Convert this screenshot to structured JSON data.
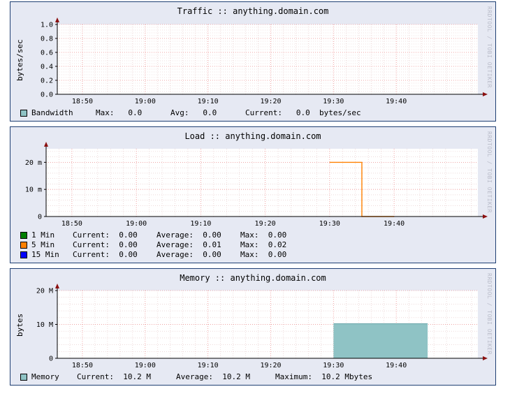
{
  "colors": {
    "panel_bg": "#e6e9f3",
    "plot_bg": "#ffffff",
    "grid_minor": "#e3c4c4",
    "grid_major": "#ee9090",
    "axis": "#000000",
    "arrow": "#8b1010"
  },
  "watermark": "RRDTOOL / TOBI OETIKER",
  "chart_data": [
    {
      "type": "line",
      "title": "Traffic :: anything.domain.com",
      "ylabel": "bytes/sec",
      "ylim": [
        0,
        1.0
      ],
      "y_ticks": [
        0.0,
        0.2,
        0.4,
        0.6,
        0.8,
        1.0
      ],
      "y_tick_labels": [
        "0.0",
        "0.2",
        "0.4",
        "0.6",
        "0.8",
        "1.0"
      ],
      "x_ticks": [
        "18:50",
        "19:00",
        "19:10",
        "19:20",
        "19:30",
        "19:40"
      ],
      "xlim": [
        "18:46",
        "19:53"
      ],
      "grid": true,
      "series": [
        {
          "name": "Bandwidth",
          "color": "#8fc3c5",
          "style": "area",
          "x": [],
          "values": [],
          "stats": {
            "Max": "0.0",
            "Avg": "0.0",
            "Current": "0.0",
            "unit": "bytes/sec"
          }
        }
      ],
      "legend": [
        {
          "swatch": "#8fc3c5",
          "label": "Bandwidth",
          "cols": [
            "Max:   0.0",
            "Avg:   0.0",
            "Current:   0.0  bytes/sec"
          ]
        }
      ]
    },
    {
      "type": "line",
      "title": "Load :: anything.domain.com",
      "ylabel": "",
      "ylim": [
        0,
        0.025
      ],
      "y_ticks": [
        0,
        0.01,
        0.02
      ],
      "y_tick_labels": [
        "0",
        "10 m",
        "20 m"
      ],
      "x_ticks": [
        "18:50",
        "19:00",
        "19:10",
        "19:20",
        "19:30",
        "19:40"
      ],
      "xlim": [
        "18:46",
        "19:53"
      ],
      "grid": true,
      "series": [
        {
          "name": "1 Min",
          "color": "#007f00",
          "x": [],
          "values": []
        },
        {
          "name": "5 Min",
          "color": "#ff8000",
          "x": [
            "19:30",
            "19:35",
            "19:35",
            "19:40"
          ],
          "values": [
            0.02,
            0.02,
            0,
            0
          ]
        },
        {
          "name": "15 Min",
          "color": "#0000ff",
          "x": [],
          "values": []
        }
      ],
      "legend": [
        {
          "swatch": "#007f00",
          "label": "1 Min ",
          "cols": [
            "Current:  0.00",
            "Average:  0.00",
            "Max:  0.00"
          ]
        },
        {
          "swatch": "#ff8000",
          "label": "5 Min ",
          "cols": [
            "Current:  0.00",
            "Average:  0.01",
            "Max:  0.02"
          ]
        },
        {
          "swatch": "#0000ff",
          "label": "15 Min",
          "cols": [
            "Current:  0.00",
            "Average:  0.00",
            "Max:  0.00"
          ]
        }
      ]
    },
    {
      "type": "area",
      "title": "Memory :: anything.domain.com",
      "ylabel": "bytes",
      "ylim": [
        0,
        20000000
      ],
      "y_ticks": [
        0,
        10000000,
        20000000
      ],
      "y_tick_labels": [
        "0",
        "10 M",
        "20 M"
      ],
      "x_ticks": [
        "18:50",
        "19:00",
        "19:10",
        "19:20",
        "19:30",
        "19:40"
      ],
      "xlim": [
        "18:46",
        "19:53"
      ],
      "grid": true,
      "series": [
        {
          "name": "Memory",
          "color": "#8fc3c5",
          "style": "area",
          "x": [
            "19:30",
            "19:45"
          ],
          "values": [
            10200000,
            10200000
          ]
        }
      ],
      "legend": [
        {
          "swatch": "#8fc3c5",
          "label": "Memory",
          "cols": [
            "Current:  10.2 M",
            "Average:  10.2 M",
            "Maximum:  10.2 Mbytes"
          ]
        }
      ]
    }
  ]
}
